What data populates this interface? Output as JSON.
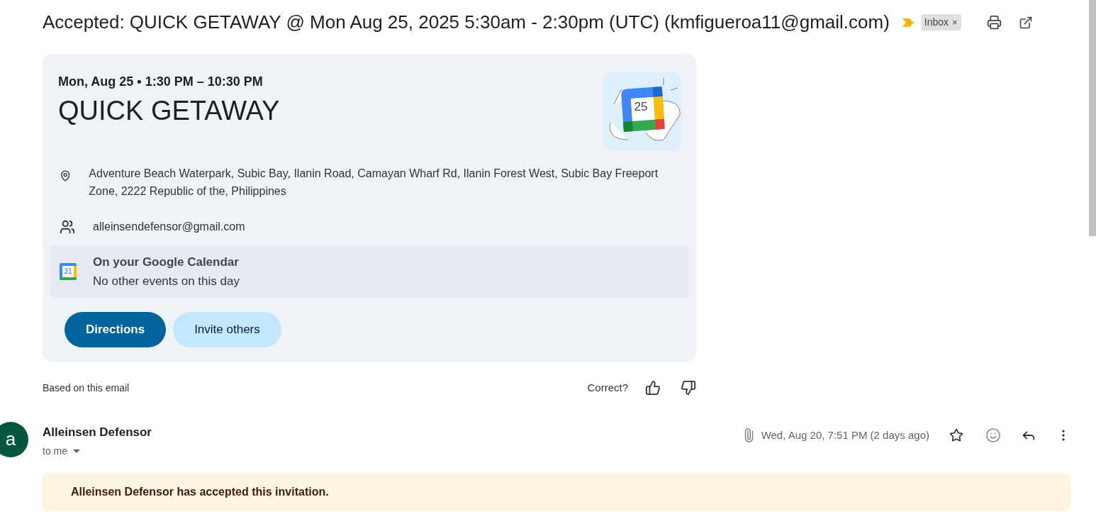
{
  "subject": {
    "title": "Accepted: QUICK GETAWAY @ Mon Aug 25, 2025 5:30am - 2:30pm (UTC) (kmfigueroa11@gmail.com)",
    "important": true,
    "label": "Inbox",
    "label_remove": "×"
  },
  "event_card": {
    "when": "Mon, Aug 25 • 1:30 PM – 10:30 PM",
    "event_title": "QUICK GETAWAY",
    "location": "Adventure Beach Waterpark, Subic Bay, Ilanin Road, Camayan Wharf Rd, Ilanin Forest West, Subic Bay Freeport Zone, 2222 Republic of the, Philippines",
    "guest": "alleinsendefensor@gmail.com",
    "calendar_icon_day": "25",
    "calendar_badge_day": "31",
    "calendar_title": "On your Google Calendar",
    "calendar_note": "No other events on this day",
    "buttons": [
      {
        "label": "Directions",
        "kind": "primary"
      },
      {
        "label": "Invite others",
        "kind": "secondary"
      }
    ]
  },
  "feedback": {
    "source": "Based on this email",
    "question": "Correct?"
  },
  "message": {
    "avatar_letter": "a",
    "sender": "Alleinsen Defensor",
    "recipient": "to me",
    "date": "Wed, Aug 20, 7:51 PM (2 days ago)",
    "starred": false,
    "banner": "Alleinsen Defensor has accepted this invitation."
  }
}
